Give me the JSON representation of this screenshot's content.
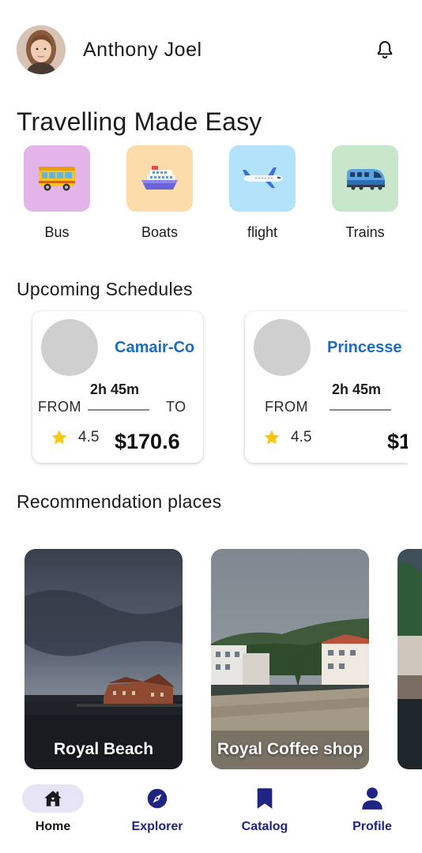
{
  "header": {
    "user_name": "Anthony Joel",
    "avatar_icon": "user-avatar",
    "notification_icon": "bell-icon"
  },
  "page_title": "Travelling Made Easy",
  "categories": [
    {
      "label": "Bus",
      "icon": "bus-icon",
      "color": "#e2b4ea"
    },
    {
      "label": "Boats",
      "icon": "ship-icon",
      "color": "#fcdcab"
    },
    {
      "label": "flight",
      "icon": "airplane-icon",
      "color": "#b3e3fb"
    },
    {
      "label": "Trains",
      "icon": "train-icon",
      "color": "#c8e6c9"
    }
  ],
  "schedules": {
    "title": "Upcoming Schedules",
    "items": [
      {
        "operator": "Camair-Co",
        "duration": "2h 45m",
        "from_label": "FROM",
        "to_label": "TO",
        "rating": "4.5",
        "price": "$170.6"
      },
      {
        "operator": "Princesse",
        "duration": "2h 45m",
        "from_label": "FROM",
        "to_label": "",
        "rating": "4.5",
        "price": "$1"
      }
    ]
  },
  "recommendations": {
    "title": "Recommendation places",
    "items": [
      {
        "name": "Royal Beach"
      },
      {
        "name": "Royal Coffee shop"
      },
      {
        "name": ""
      }
    ]
  },
  "nav": {
    "items": [
      {
        "label": "Home",
        "icon": "home-icon",
        "active": true
      },
      {
        "label": "Explorer",
        "icon": "compass-icon",
        "active": false
      },
      {
        "label": "Catalog",
        "icon": "bookmark-icon",
        "active": false
      },
      {
        "label": "Profile",
        "icon": "person-icon",
        "active": false
      }
    ]
  },
  "colors": {
    "accent_blue": "#1c6bbd",
    "nav_indigo": "#1f2382",
    "active_pill": "#e6e4f5",
    "star": "#f9c80e"
  }
}
